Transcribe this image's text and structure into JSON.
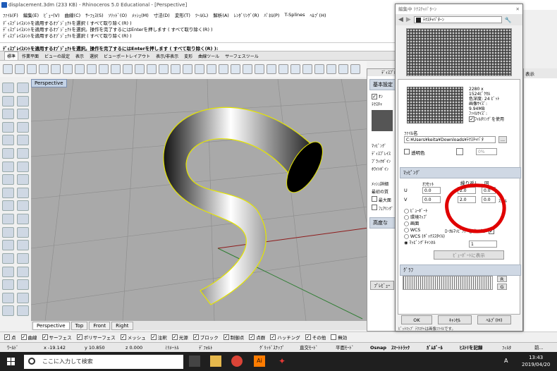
{
  "window": {
    "title": "displacement.3dm (233 KB) - Rhinoceros 5.0 Educational - [Perspective]"
  },
  "menu": [
    "ﾌｧｲﾙ(F)",
    "編集(E)",
    "ﾋﾞｭｰ(V)",
    "曲線(C)",
    "ｻｰﾌｪｽ(S)",
    "ｿﾘｯﾄﾞ(O)",
    "ﾒｯｼｭ(M)",
    "寸法(D)",
    "変形(T)",
    "ﾂｰﾙ(L)",
    "解析(A)",
    "ﾚﾝﾀﾞﾘﾝｸﾞ(R)",
    "ﾊﾟﾈﾙ(P)",
    "T-Splines",
    "ﾍﾙﾌﾟ(H)"
  ],
  "command": {
    "history": [
      "ﾃﾞｨｽﾌﾟﾚｲｽﾒﾝﾄを適用するｵﾌﾞｼﾞｪｸﾄを選択 ( すべて取り除く(R) )",
      "ﾃﾞｨｽﾌﾟﾚｲｽﾒﾝﾄを適用するｵﾌﾞｼﾞｪｸﾄを選択。操作を完了するにはEnterを押します ( すべて取り除く(R) )",
      "ﾃﾞｨｽﾌﾟﾚｲｽﾒﾝﾄを適用するｵﾌﾞｼﾞｪｸﾄを選択 ( すべて取り除く(R) )"
    ],
    "prompt": "ﾃﾞｨｽﾌﾟﾚｲｽﾒﾝﾄを適用するｵﾌﾞｼﾞｪｸﾄを選択。操作を完了するにはEnterを押します ( すべて取り除く(R) ):"
  },
  "toolbar_tabs": [
    "標準",
    "作業平面",
    "ビューの設定",
    "表示",
    "選択",
    "ビューポートレイアウト",
    "表示/非表示",
    "変形",
    "曲線ツール",
    "サーフェスツール"
  ],
  "viewport": {
    "name": "Perspective",
    "tabs": [
      "Perspective",
      "Top",
      "Front",
      "Right"
    ]
  },
  "osnap": [
    "点",
    "曲線",
    "サーフェス",
    "ポリサーフェス",
    "メッシュ",
    "注釈",
    "光源",
    "ブロック",
    "制御点",
    "点群",
    "ハッチング",
    "その他",
    "無効"
  ],
  "osnap_checked": [
    true,
    true,
    true,
    true,
    true,
    true,
    true,
    true,
    true,
    true,
    true,
    true,
    false
  ],
  "status": {
    "world": "ﾜｰﾙﾄﾞ",
    "x": "x -19.142",
    "y": "y 10.850",
    "z": "z 0.000",
    "unit": "ﾐﾘﾒｰﾄﾙ",
    "layer": "ﾃﾞﾌｫﾙﾄ",
    "grid_snap": "ｸﾞﾘｯﾄﾞｽﾅｯﾌﾟ",
    "ortho": "直交ﾓｰﾄﾞ",
    "planar": "平面ﾓｰﾄﾞ",
    "osnap": "Osnap",
    "smart": "ｽﾏｰﾄﾄﾗｯｸ",
    "gumball": "ｶﾞﾑﾎﾞｰﾙ",
    "history": "ﾋｽﾄﾘを記録",
    "filter": "ﾌｨﾙﾀ",
    "more": "前..."
  },
  "props": {
    "title": "ﾃﾞｨｽﾌﾟﾚｲｽﾒﾝﾄ",
    "header": "基本設定",
    "on": "ｵﾝ",
    "texture": "ﾃｸｽﾁｬ",
    "mapping": "ﾏｯﾋﾟﾝｸﾞ",
    "disp": "ﾃﾞｨｽﾌﾟﾚｲｽ",
    "black": "ﾌﾞﾗｯｸﾎﾟｲﾝ",
    "white": "ﾎﾜｲﾄﾎﾟｲﾝ",
    "mesh": "ﾒｯｼｭ詳細",
    "min": "最初の質",
    "max": "最大面",
    "fair": "ﾌｪｱﾘﾝｸﾞ",
    "adv": "高度な",
    "preview": "ﾌﾟﾚﾋﾞｭｰ"
  },
  "dialog": {
    "title": "編集中 ﾃｸｽﾁｬﾊﾟﾀｰﾝ",
    "path": "ﾃｸｽﾁｬﾊﾟﾀｰﾝ",
    "info": [
      "2280 x",
      "1524ﾋﾟｸｾﾙ",
      "色深度: 24 ﾋﾞｯﾄ",
      "画像ｻｲｽﾞ:",
      "9.94MB",
      "ﾌｧｲﾙｻｲｽﾞ:"
    ],
    "filter_label": "ﾌｨﾙﾀﾘﾝｸﾞを使用",
    "filename_label": "ﾌｧｲﾙ名",
    "filename": "C:¥Users¥keita¥Downloads¥ﾃｸｽﾁｬﾊﾟﾀ",
    "transparent": "透明色",
    "percent": "0%",
    "mapping_header": "ﾏｯﾋﾟﾝｸﾞ",
    "offset": "ｵﾌｾｯﾄ",
    "repeat": "繰り返し",
    "rotate": "回",
    "u": "U",
    "v": "V",
    "u_offset": "0.0",
    "v_offset": "0.0",
    "u_repeat": "2.0",
    "v_repeat": "2.0",
    "u_rot": "0.0",
    "v_rot": "0.0",
    "lock": "ﾛｯｸ",
    "scale": "ｽｹｰﾙ",
    "viewport_opt": "ﾋﾞｭｰﾎﾟｰﾄ",
    "env": "環境ﾏｯﾌﾟ",
    "screen": "画面",
    "wcs": "WCS",
    "wcs_box": "WCS (ﾎﾞｯｸｽｽﾀｲﾙ)",
    "channel": "ﾏｯﾋﾟﾝｸﾞﾁｬﾝﾈﾙ",
    "channel_val": "1",
    "local_preview": "ﾛｰｶﾙﾏｯﾋﾟﾝｸﾞをﾌﾟﾚﾋﾞｭｰ",
    "show_in_vp": "ﾋﾞｭｰﾎﾟｰﾄに表示",
    "graph": "ｸﾞﾗﾌ",
    "r": "R",
    "g": "G",
    "ok": "OK",
    "cancel": "ｷｬﾝｾﾙ",
    "help": "ﾍﾙﾌﾟ(H)",
    "footer": "ﾋﾞｯﾄﾏｯﾌﾟ ﾃｸｽﾁｬは画像ﾌｧｲﾙです。"
  },
  "right": {
    "display": "表示",
    "icon1": "⌂"
  },
  "taskbar": {
    "search": "ここに入力して検索",
    "time": "13:43",
    "date": "2019/04/20",
    "ime": "A"
  },
  "colors": {
    "annotation": "#e00000",
    "selection": "#e5e500"
  }
}
